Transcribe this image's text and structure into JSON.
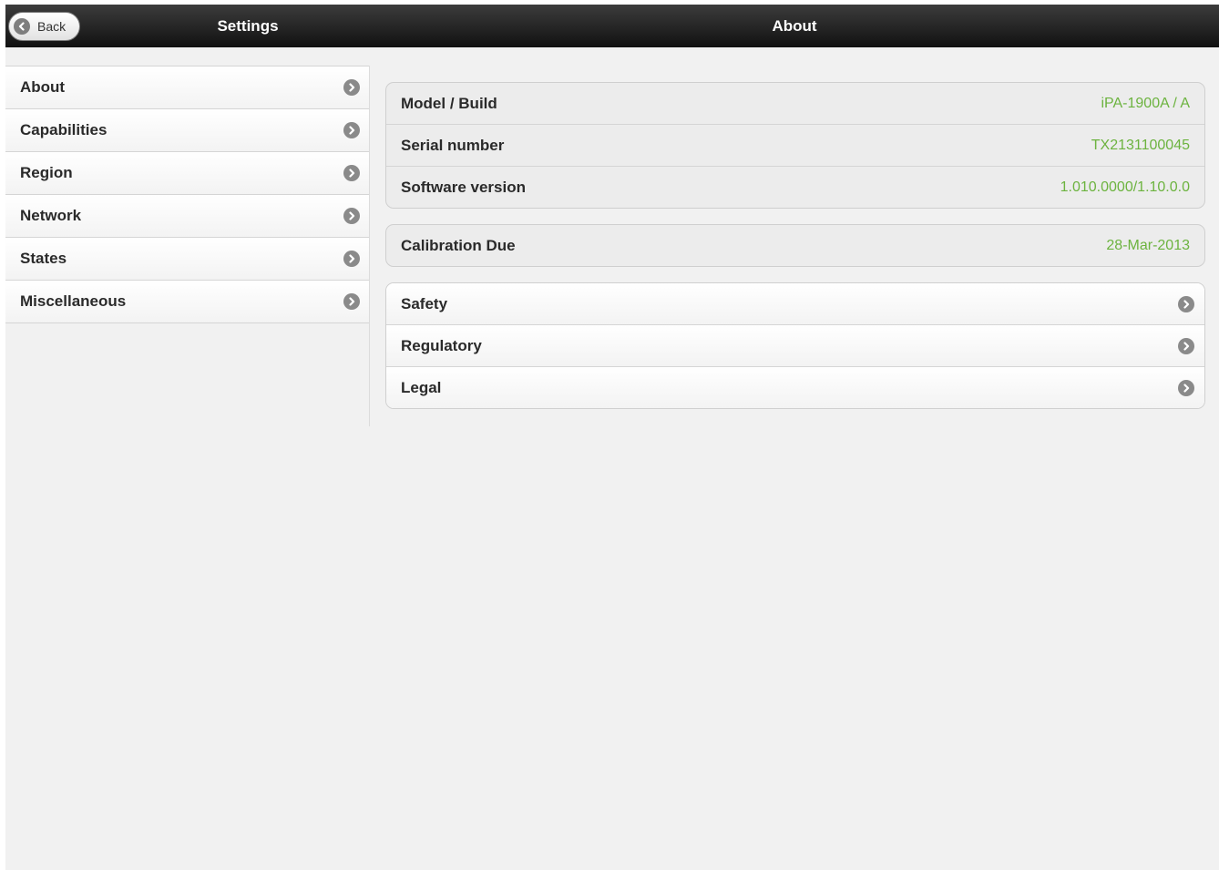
{
  "header": {
    "back_label": "Back",
    "left_title": "Settings",
    "right_title": "About"
  },
  "sidebar": {
    "items": [
      {
        "label": "About"
      },
      {
        "label": "Capabilities"
      },
      {
        "label": "Region"
      },
      {
        "label": "Network"
      },
      {
        "label": "States"
      },
      {
        "label": "Miscellaneous"
      }
    ]
  },
  "about": {
    "info": [
      {
        "label": "Model / Build",
        "value": "iPA-1900A / A"
      },
      {
        "label": "Serial number",
        "value": "TX2131100045"
      },
      {
        "label": "Software version",
        "value": "1.010.0000/1.10.0.0"
      }
    ],
    "calibration": {
      "label": "Calibration Due",
      "value": "28-Mar-2013"
    },
    "links": [
      {
        "label": "Safety"
      },
      {
        "label": "Regulatory"
      },
      {
        "label": "Legal"
      }
    ]
  },
  "colors": {
    "value_text": "#6cb33f",
    "topbar": "#1a1a1a",
    "background": "#f1f1f1"
  },
  "icons": {
    "back": "chevron-left-circle-icon",
    "disclosure": "chevron-right-circle-icon"
  }
}
